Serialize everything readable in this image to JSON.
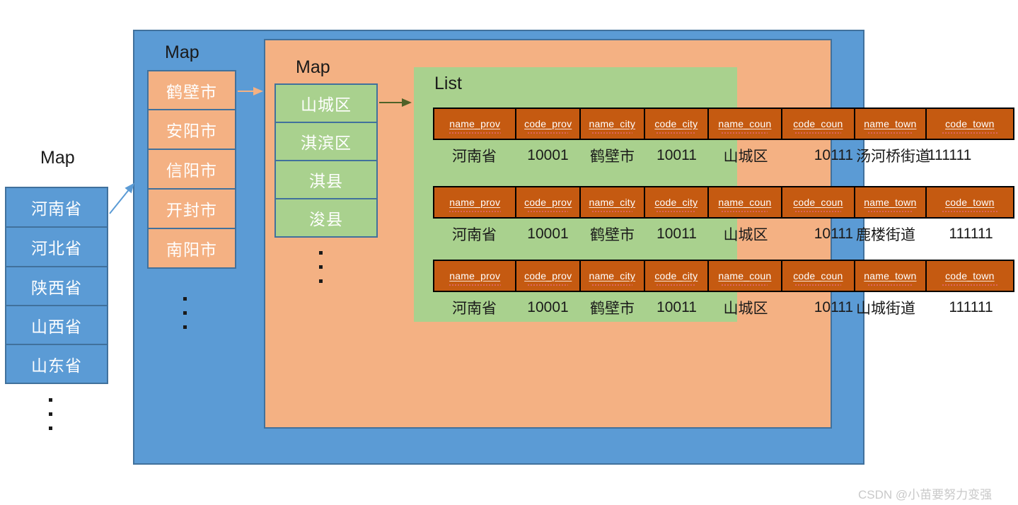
{
  "diagram": {
    "province_map": {
      "title": "Map",
      "items": [
        {
          "label": "河南省"
        },
        {
          "label": "河北省"
        },
        {
          "label": "陕西省"
        },
        {
          "label": "山西省"
        },
        {
          "label": "山东省"
        }
      ],
      "ellipsis": "⋮"
    },
    "city_map": {
      "title": "Map",
      "items": [
        {
          "label": "鹤壁市"
        },
        {
          "label": "安阳市"
        },
        {
          "label": "信阳市"
        },
        {
          "label": "开封市"
        },
        {
          "label": "南阳市"
        }
      ],
      "ellipsis": "⋮"
    },
    "county_map": {
      "title": "Map",
      "items": [
        {
          "label": "山城区"
        },
        {
          "label": "淇滨区"
        },
        {
          "label": "淇县"
        },
        {
          "label": "浚县"
        }
      ],
      "ellipsis": "⋮"
    },
    "list": {
      "title": "List",
      "columns": [
        "name_prov",
        "code_prov",
        "name_city",
        "code_city",
        "name_coun",
        "code_coun",
        "name_town",
        "code_town"
      ],
      "rows": [
        {
          "name_prov": "河南省",
          "code_prov": "10001",
          "name_city": "鹤壁市",
          "code_city": "10011",
          "name_coun": "山城区",
          "code_coun": "10111",
          "name_town": "汤河桥街道",
          "code_town": "111111"
        },
        {
          "name_prov": "河南省",
          "code_prov": "10001",
          "name_city": "鹤壁市",
          "code_city": "10011",
          "name_coun": "山城区",
          "code_coun": "10111",
          "name_town": "鹿楼街道",
          "code_town": "111111"
        },
        {
          "name_prov": "河南省",
          "code_prov": "10001",
          "name_city": "鹤壁市",
          "code_city": "10011",
          "name_coun": "山城区",
          "code_coun": "10111",
          "name_town": "山城街道",
          "code_town": "111111"
        }
      ]
    },
    "arrows": [
      {
        "name": "province-to-city-arrow",
        "color": "#5B9BD5"
      },
      {
        "name": "city-to-county-arrow",
        "color": "#F4B183"
      },
      {
        "name": "county-to-list-arrow",
        "color": "#4F6228"
      }
    ]
  },
  "colors": {
    "blue_fill": "#5B9BD5",
    "blue_border": "#41719C",
    "orange_fill": "#F4B183",
    "green_fill": "#A9D18E",
    "header_fill": "#C55A11",
    "text_dark": "#1A1A1A"
  },
  "watermark": {
    "text": "CSDN @小苗要努力变强"
  }
}
